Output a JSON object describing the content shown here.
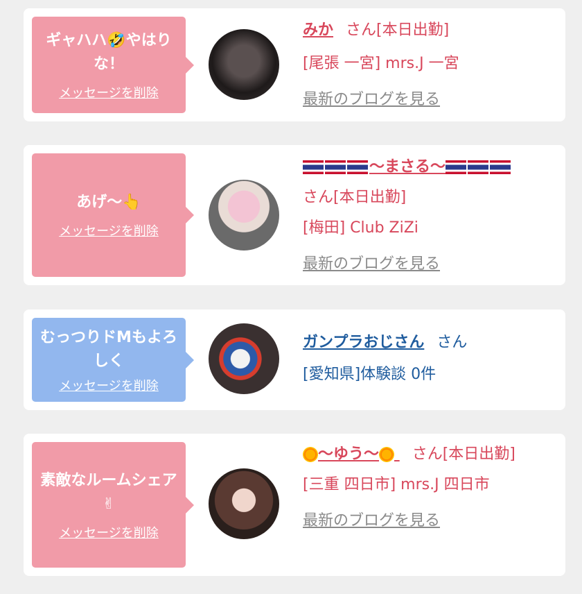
{
  "cards": [
    {
      "message": "ギャハハ🤣やはりな！",
      "delete_label": "メッセージを削除",
      "name": "みか",
      "honorific": "さん",
      "status": "[本日出勤]",
      "location": "[尾張 一宮] mrs.J 一宮",
      "blog_link": "最新のブログを見る"
    },
    {
      "message": "あげ〜👆",
      "delete_label": "メッセージを削除",
      "name": "〜まさる〜",
      "honorific": "さん",
      "status": "[本日出勤]",
      "location": "[梅田] Club ZiZi",
      "blog_link": "最新のブログを見る"
    },
    {
      "message": "むっつりドMもよろしく",
      "delete_label": "メッセージを削除",
      "name": "ガンプラおじさん",
      "honorific": "さん",
      "location": "[愛知県]体験談 0件"
    },
    {
      "message": "素敵なルームシェア✌",
      "delete_label": "メッセージを削除",
      "name": "〜ゆう〜",
      "honorific": "さん",
      "status": "[本日出勤]",
      "location": "[三重 四日市] mrs.J 四日市",
      "blog_link": "最新のブログを見る"
    }
  ],
  "colors": {
    "pink_bubble": "#f19ba8",
    "blue_bubble": "#92b7ee",
    "pink_text": "#d8475b",
    "blue_text": "#1f5c9e"
  }
}
